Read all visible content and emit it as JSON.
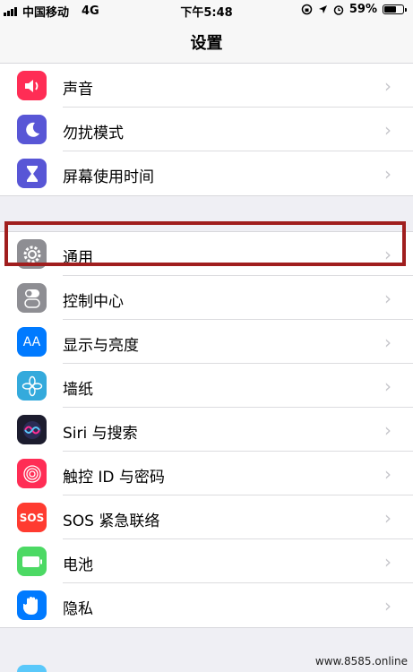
{
  "status_bar": {
    "carrier": "中国移动",
    "network": "4G",
    "time": "下午5:48",
    "battery": "59%"
  },
  "nav": {
    "title": "设置"
  },
  "groups": [
    {
      "items": [
        {
          "label": "声音",
          "icon": "speaker-icon",
          "color": "#ff2d55"
        },
        {
          "label": "勿扰模式",
          "icon": "moon-icon",
          "color": "#5856d6"
        },
        {
          "label": "屏幕使用时间",
          "icon": "hourglass-icon",
          "color": "#5856d6"
        }
      ]
    },
    {
      "items": [
        {
          "label": "通用",
          "icon": "gear-icon",
          "color": "#8e8e93"
        },
        {
          "label": "控制中心",
          "icon": "toggles-icon",
          "color": "#8e8e93"
        },
        {
          "label": "显示与亮度",
          "icon": "aa-icon",
          "color": "#007aff"
        },
        {
          "label": "墙纸",
          "icon": "flower-icon",
          "color": "#34aadc"
        },
        {
          "label": "Siri 与搜索",
          "icon": "siri-icon",
          "color": "#1c1c2e"
        },
        {
          "label": "触控 ID 与密码",
          "icon": "fingerprint-icon",
          "color": "#ff2d55"
        },
        {
          "label": "SOS 紧急联络",
          "icon": "sos-icon",
          "color": "#ff3b30"
        },
        {
          "label": "电池",
          "icon": "battery-icon",
          "color": "#4cd964"
        },
        {
          "label": "隐私",
          "icon": "hand-icon",
          "color": "#007aff"
        }
      ]
    }
  ],
  "watermark": "www.8585.online"
}
